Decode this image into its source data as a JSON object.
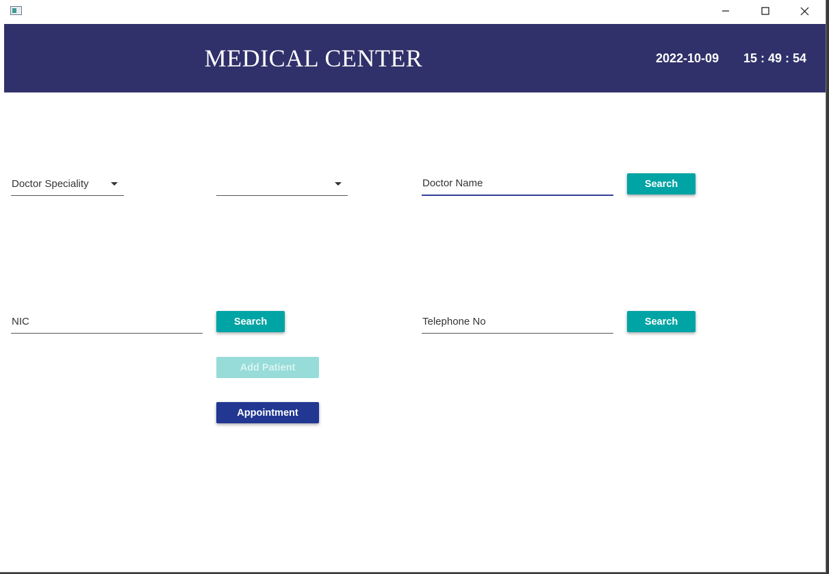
{
  "window": {
    "icons": {
      "app": "app-icon",
      "minimize": "minimize-icon",
      "maximize": "maximize-icon",
      "close": "close-icon"
    }
  },
  "header": {
    "title": "MEDICAL CENTER",
    "date": "2022-10-09",
    "time": "15 : 49 : 54",
    "background_color": "#30316a"
  },
  "form": {
    "speciality_combo": {
      "value": "Doctor Speciality",
      "icon": "dropdown-arrow-icon"
    },
    "doctor_combo": {
      "value": "",
      "icon": "dropdown-arrow-icon"
    },
    "doctor_name": {
      "placeholder": "Doctor Name"
    },
    "doctor_search_label": "Search",
    "nic": {
      "placeholder": "NIC"
    },
    "nic_search_label": "Search",
    "telephone": {
      "placeholder": "Telephone No"
    },
    "telephone_search_label": "Search",
    "add_patient_label": "Add Patient",
    "appointment_label": "Appointment"
  },
  "colors": {
    "search_button": "#01a4a4",
    "add_patient_disabled": "#97dcd9",
    "appointment_button": "#223792"
  }
}
